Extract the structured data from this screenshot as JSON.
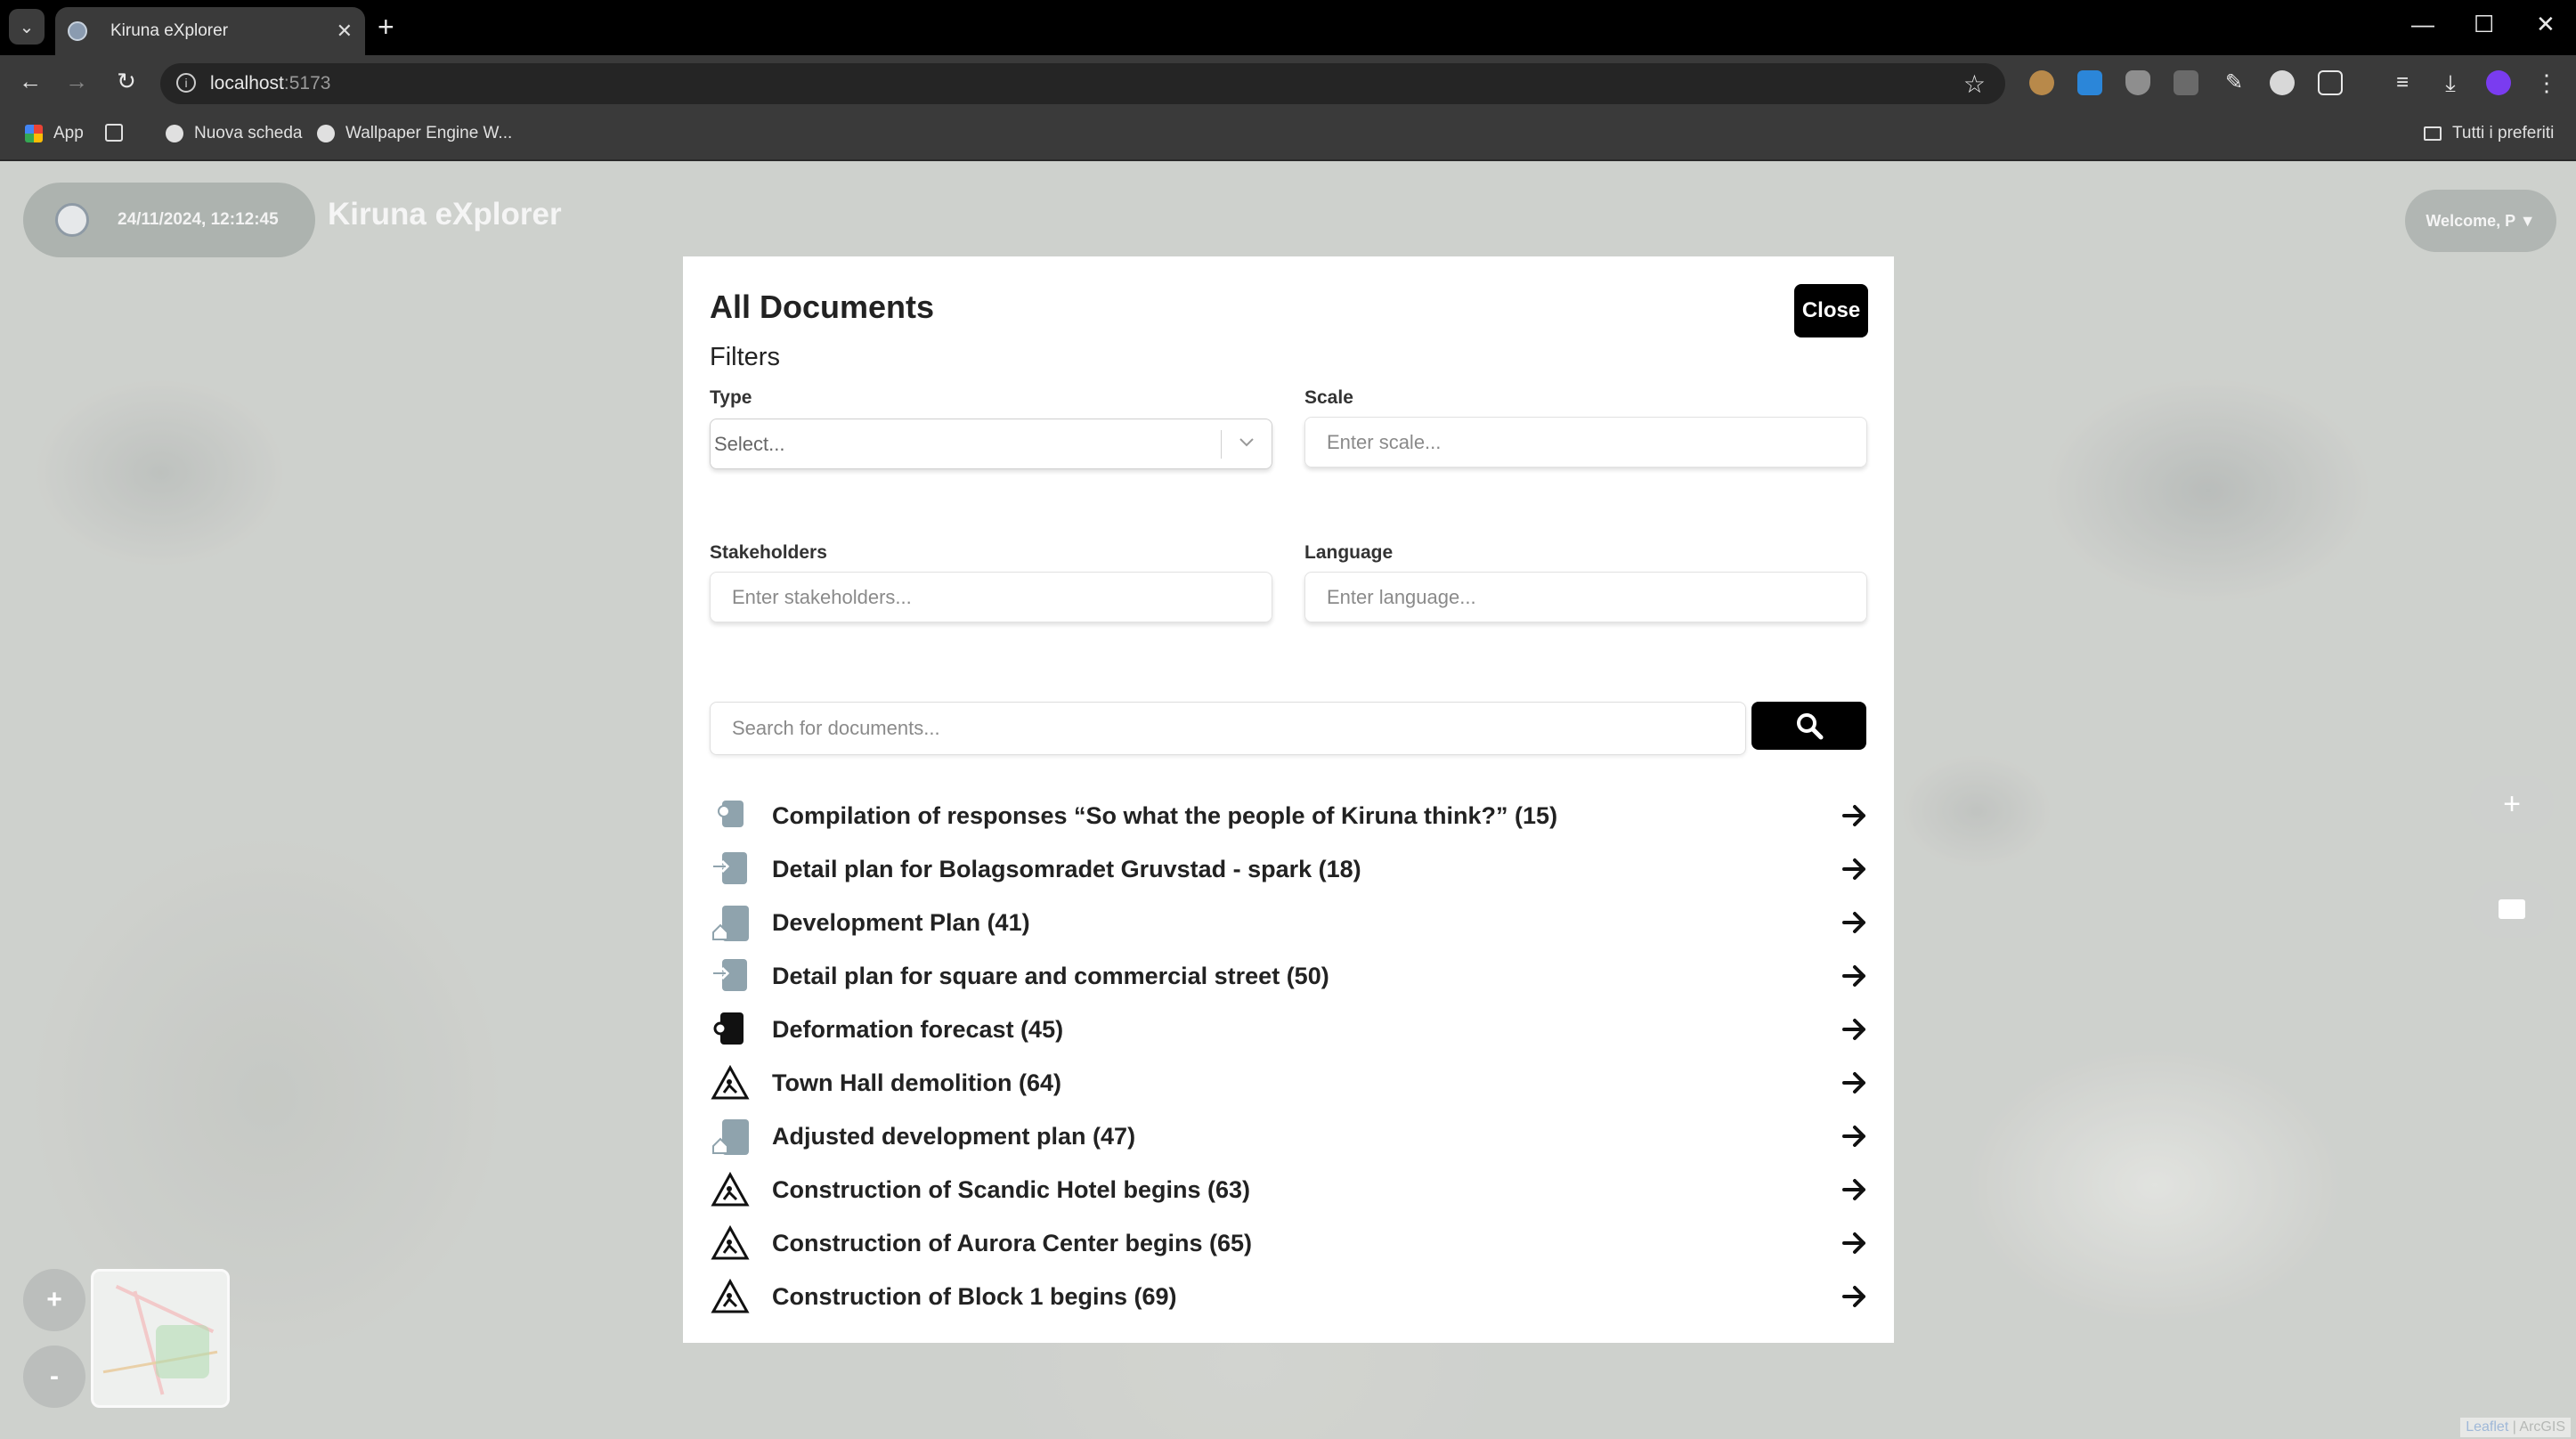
{
  "browser": {
    "tab_title": "Kiruna eXplorer",
    "url_host": "localhost",
    "url_port": ":5173",
    "bookmarks": [
      "App",
      "Nuova scheda",
      "Wallpaper Engine W..."
    ],
    "all_bookmarks_label": "Tutti i preferiti"
  },
  "app": {
    "datetime": "24/11/2024, 12:12:45",
    "title": "Kiruna eXplorer",
    "welcome": "Welcome, P ▼",
    "zoom_in": "+",
    "zoom_out": "-",
    "add_label": "+",
    "attribution_leaflet": "Leaflet",
    "attribution_rest": " | ArcGIS"
  },
  "modal": {
    "title": "All Documents",
    "close_label": "Close",
    "filters_heading": "Filters",
    "type_label": "Type",
    "type_value": "Select...",
    "scale_label": "Scale",
    "scale_placeholder": "Enter scale...",
    "stakeholders_label": "Stakeholders",
    "stakeholders_placeholder": "Enter stakeholders...",
    "language_label": "Language",
    "language_placeholder": "Enter language...",
    "search_placeholder": "Search for documents...",
    "documents": [
      {
        "label": "Compilation of responses “So what the people of Kiruna think?” (15)",
        "icon": "consultation-icon"
      },
      {
        "label": "Detail plan for Bolagsomradet Gruvstad - spark (18)",
        "icon": "prescriptive-document-icon"
      },
      {
        "label": "Development Plan (41)",
        "icon": "design-document-icon"
      },
      {
        "label": "Detail plan for square and commercial street (50)",
        "icon": "prescriptive-document-icon"
      },
      {
        "label": "Deformation forecast (45)",
        "icon": "technical-document-icon"
      },
      {
        "label": "Town Hall demolition (64)",
        "icon": "material-effect-icon"
      },
      {
        "label": "Adjusted development plan (47)",
        "icon": "design-document-icon"
      },
      {
        "label": "Construction of Scandic Hotel begins (63)",
        "icon": "material-effect-icon"
      },
      {
        "label": "Construction of Aurora Center begins (65)",
        "icon": "material-effect-icon"
      },
      {
        "label": "Construction of Block 1 begins (69)",
        "icon": "material-effect-icon"
      }
    ]
  }
}
